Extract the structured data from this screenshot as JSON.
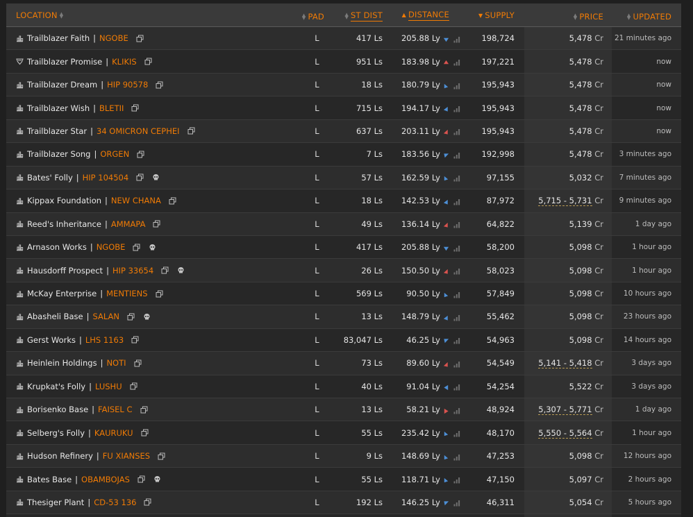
{
  "colors": {
    "accent": "#f07b05",
    "arrow_up": "#d9534f",
    "arrow_down": "#4d8fd6",
    "text": "#e8e8e8"
  },
  "header": {
    "location": "LOCATION",
    "pad": "PAD",
    "st_dist": "ST DIST",
    "distance": "DISTANCE",
    "supply": "SUPPLY",
    "price": "PRICE",
    "updated": "UPDATED"
  },
  "rows": [
    {
      "station": "Trailblazer Faith",
      "system": "NGOBE",
      "type": "carrier",
      "skull": false,
      "pad": "L",
      "st_dist": "417 Ls",
      "distance": "205.88 Ly",
      "dir": "down",
      "supply": "198,724",
      "price": "5,478",
      "range": false,
      "updated": "21 minutes ago"
    },
    {
      "station": "Trailblazer Promise",
      "system": "KLIKIS",
      "type": "shield",
      "skull": false,
      "pad": "L",
      "st_dist": "951 Ls",
      "distance": "183.98 Ly",
      "dir": "up",
      "supply": "197,221",
      "price": "5,478",
      "range": false,
      "updated": "now"
    },
    {
      "station": "Trailblazer Dream",
      "system": "HIP 90578",
      "type": "carrier",
      "skull": false,
      "pad": "L",
      "st_dist": "18 Ls",
      "distance": "180.79 Ly",
      "dir": "upright",
      "supply": "195,943",
      "price": "5,478",
      "range": false,
      "updated": "now"
    },
    {
      "station": "Trailblazer Wish",
      "system": "BLETII",
      "type": "carrier",
      "skull": false,
      "pad": "L",
      "st_dist": "715 Ls",
      "distance": "194.17 Ly",
      "dir": "downleft",
      "supply": "195,943",
      "price": "5,478",
      "range": false,
      "updated": "now"
    },
    {
      "station": "Trailblazer Star",
      "system": "34 OMICRON CEPHEI",
      "type": "carrier",
      "skull": false,
      "pad": "L",
      "st_dist": "637 Ls",
      "distance": "203.11 Ly",
      "dir": "upleft",
      "supply": "195,943",
      "price": "5,478",
      "range": false,
      "updated": "now"
    },
    {
      "station": "Trailblazer Song",
      "system": "ORGEN",
      "type": "carrier",
      "skull": false,
      "pad": "L",
      "st_dist": "7 Ls",
      "distance": "183.56 Ly",
      "dir": "downright",
      "supply": "192,998",
      "price": "5,478",
      "range": false,
      "updated": "3 minutes ago"
    },
    {
      "station": "Bates' Folly",
      "system": "HIP 104504",
      "type": "carrier",
      "skull": true,
      "pad": "L",
      "st_dist": "57 Ls",
      "distance": "162.59 Ly",
      "dir": "upright",
      "supply": "97,155",
      "price": "5,032",
      "range": false,
      "updated": "7 minutes ago"
    },
    {
      "station": "Kippax Foundation",
      "system": "NEW CHANA",
      "type": "carrier",
      "skull": false,
      "pad": "L",
      "st_dist": "18 Ls",
      "distance": "142.53 Ly",
      "dir": "downleft",
      "supply": "87,972",
      "price": "5,715 - 5,731",
      "range": true,
      "updated": "9 minutes ago"
    },
    {
      "station": "Reed's Inheritance",
      "system": "AMMAPA",
      "type": "carrier",
      "skull": false,
      "pad": "L",
      "st_dist": "49 Ls",
      "distance": "136.14 Ly",
      "dir": "upleft",
      "supply": "64,822",
      "price": "5,139",
      "range": false,
      "updated": "1 day ago"
    },
    {
      "station": "Arnason Works",
      "system": "NGOBE",
      "type": "carrier",
      "skull": true,
      "pad": "L",
      "st_dist": "417 Ls",
      "distance": "205.88 Ly",
      "dir": "down",
      "supply": "58,200",
      "price": "5,098",
      "range": false,
      "updated": "1 hour ago"
    },
    {
      "station": "Hausdorff Prospect",
      "system": "HIP 33654",
      "type": "carrier",
      "skull": true,
      "pad": "L",
      "st_dist": "26 Ls",
      "distance": "150.50 Ly",
      "dir": "upleft",
      "supply": "58,023",
      "price": "5,098",
      "range": false,
      "updated": "1 hour ago"
    },
    {
      "station": "McKay Enterprise",
      "system": "MENTIENS",
      "type": "carrier",
      "skull": false,
      "pad": "L",
      "st_dist": "569 Ls",
      "distance": "90.50 Ly",
      "dir": "upright",
      "supply": "57,849",
      "price": "5,098",
      "range": false,
      "updated": "10 hours ago"
    },
    {
      "station": "Abasheli Base",
      "system": "SALAN",
      "type": "carrier",
      "skull": true,
      "pad": "L",
      "st_dist": "13 Ls",
      "distance": "148.79 Ly",
      "dir": "downleft",
      "supply": "55,462",
      "price": "5,098",
      "range": false,
      "updated": "23 hours ago"
    },
    {
      "station": "Gerst Works",
      "system": "LHS 1163",
      "type": "carrier",
      "skull": false,
      "pad": "L",
      "st_dist": "83,047 Ls",
      "distance": "46.25 Ly",
      "dir": "downright",
      "supply": "54,963",
      "price": "5,098",
      "range": false,
      "updated": "14 hours ago"
    },
    {
      "station": "Heinlein Holdings",
      "system": "NOTI",
      "type": "carrier",
      "skull": false,
      "pad": "L",
      "st_dist": "73 Ls",
      "distance": "89.60 Ly",
      "dir": "upleft",
      "supply": "54,549",
      "price": "5,141 - 5,418",
      "range": true,
      "updated": "3 days ago"
    },
    {
      "station": "Krupkat's Folly",
      "system": "LUSHU",
      "type": "carrier",
      "skull": false,
      "pad": "L",
      "st_dist": "40 Ls",
      "distance": "91.04 Ly",
      "dir": "left",
      "supply": "54,254",
      "price": "5,522",
      "range": false,
      "updated": "3 days ago"
    },
    {
      "station": "Borisenko Base",
      "system": "FAISEL C",
      "type": "carrier",
      "skull": false,
      "pad": "L",
      "st_dist": "13 Ls",
      "distance": "58.21 Ly",
      "dir": "right",
      "supply": "48,924",
      "price": "5,307 - 5,771",
      "range": true,
      "updated": "1 day ago"
    },
    {
      "station": "Selberg's Folly",
      "system": "KAURUKU",
      "type": "carrier",
      "skull": false,
      "pad": "L",
      "st_dist": "55 Ls",
      "distance": "235.42 Ly",
      "dir": "upright",
      "supply": "48,170",
      "price": "5,550 - 5,564",
      "range": true,
      "updated": "1 hour ago"
    },
    {
      "station": "Hudson Refinery",
      "system": "FU XIANSES",
      "type": "carrier",
      "skull": false,
      "pad": "L",
      "st_dist": "9 Ls",
      "distance": "148.69 Ly",
      "dir": "upright",
      "supply": "47,253",
      "price": "5,098",
      "range": false,
      "updated": "12 hours ago"
    },
    {
      "station": "Bates Base",
      "system": "OBAMBOJAS",
      "type": "carrier",
      "skull": true,
      "pad": "L",
      "st_dist": "55 Ls",
      "distance": "118.71 Ly",
      "dir": "upright",
      "supply": "47,150",
      "price": "5,097",
      "range": false,
      "updated": "2 hours ago"
    },
    {
      "station": "Thesiger Plant",
      "system": "CD-53 136",
      "type": "carrier",
      "skull": false,
      "pad": "L",
      "st_dist": "192 Ls",
      "distance": "146.25 Ly",
      "dir": "downright",
      "supply": "46,311",
      "price": "5,054",
      "range": false,
      "updated": "5 hours ago"
    },
    {
      "station": "",
      "system": "",
      "type": "carrier",
      "skull": false,
      "pad": "",
      "st_dist": "",
      "distance": "",
      "dir": "down",
      "supply": "",
      "price": "",
      "range": false,
      "updated": ""
    }
  ],
  "cr_label": "Cr"
}
